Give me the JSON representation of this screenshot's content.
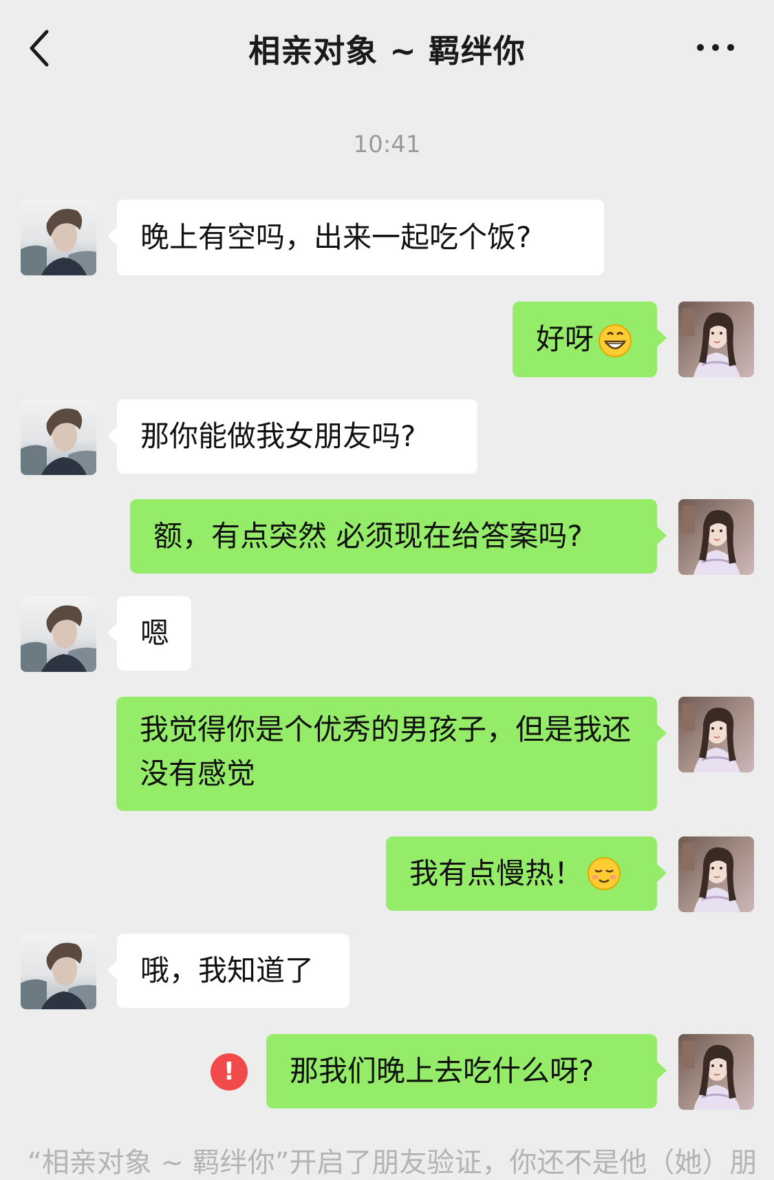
{
  "header": {
    "title": "相亲对象 ~ 羁绊你",
    "back_icon": "chevron-left-icon",
    "more_icon": "more-dots-icon"
  },
  "timestamp": "10:41",
  "messages": [
    {
      "side": "in",
      "text": "晚上有空吗，出来一起吃个饭?"
    },
    {
      "side": "out",
      "text": "好呀",
      "emoji": "grinning-face-emoji"
    },
    {
      "side": "in",
      "text": "那你能做我女朋友吗?"
    },
    {
      "side": "out",
      "text": "额，有点突然 必须现在给答案吗?"
    },
    {
      "side": "in",
      "text": "嗯"
    },
    {
      "side": "out",
      "text": "我觉得你是个优秀的男孩子，但是我还没有感觉"
    },
    {
      "side": "out",
      "text": "我有点慢热！",
      "emoji": "shy-smile-emoji"
    },
    {
      "side": "in",
      "text": "哦，我知道了"
    },
    {
      "side": "out",
      "text": "那我们晚上去吃什么呀?",
      "status": "failed-to-send"
    }
  ],
  "colors": {
    "background": "#ededed",
    "incoming_bubble": "#ffffff",
    "outgoing_bubble": "#95ec69",
    "error": "#f04a4a",
    "timestamp": "#9a9a9a"
  },
  "footer_partial": "“相亲对象 ~ 羁绊你”开启了朋友验证，你还不是他（她）朋友"
}
